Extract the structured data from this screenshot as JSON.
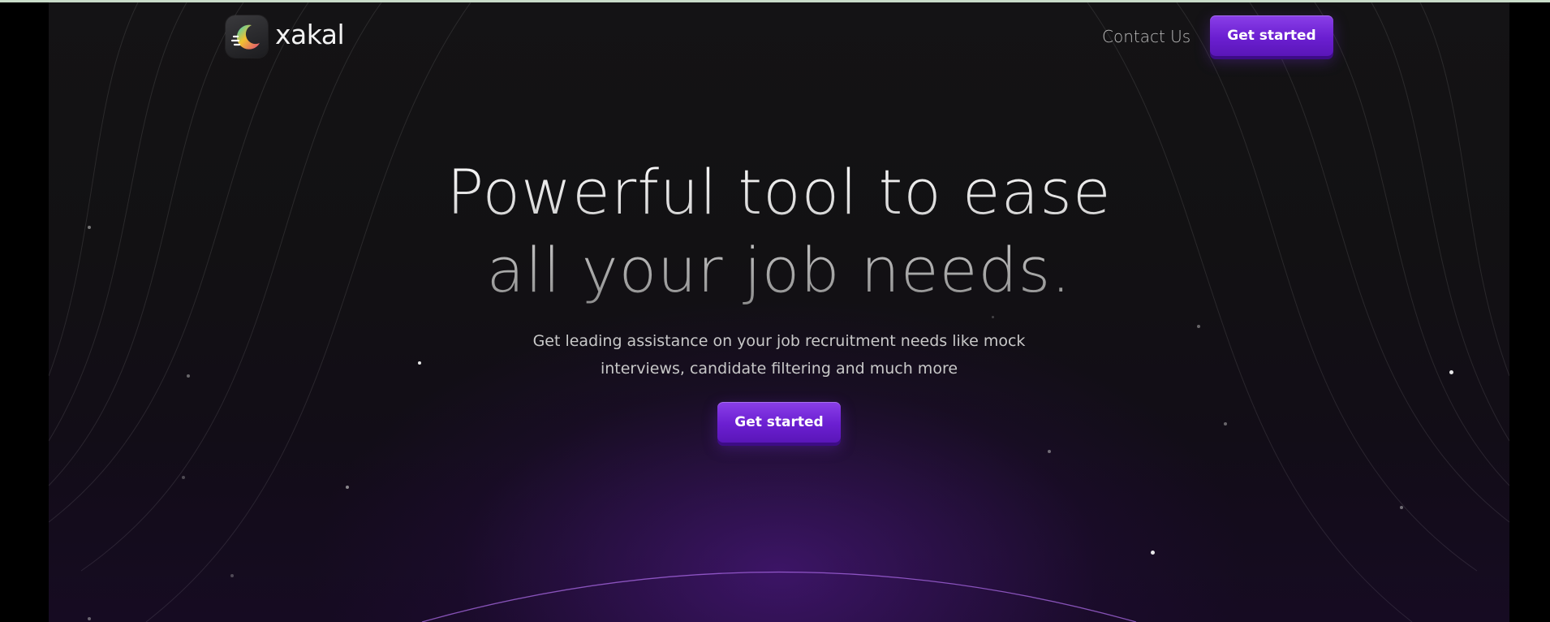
{
  "nav": {
    "brand": "xakal",
    "contact_label": "Contact Us",
    "cta_label": "Get started"
  },
  "hero": {
    "headline_line1": "Powerful tool to ease",
    "headline_line2": "all your job needs.",
    "subtext_line1": "Get leading assistance on your job recruitment needs like mock",
    "subtext_line2": "interviews, candidate filtering and much more",
    "cta_label": "Get started"
  },
  "colors": {
    "accent": "#6b1fd1",
    "background": "#121113",
    "glow": "#5c1ca0",
    "text": "#c8c8c8"
  },
  "icons": {
    "logo": "crescent-moon-logo-icon"
  }
}
